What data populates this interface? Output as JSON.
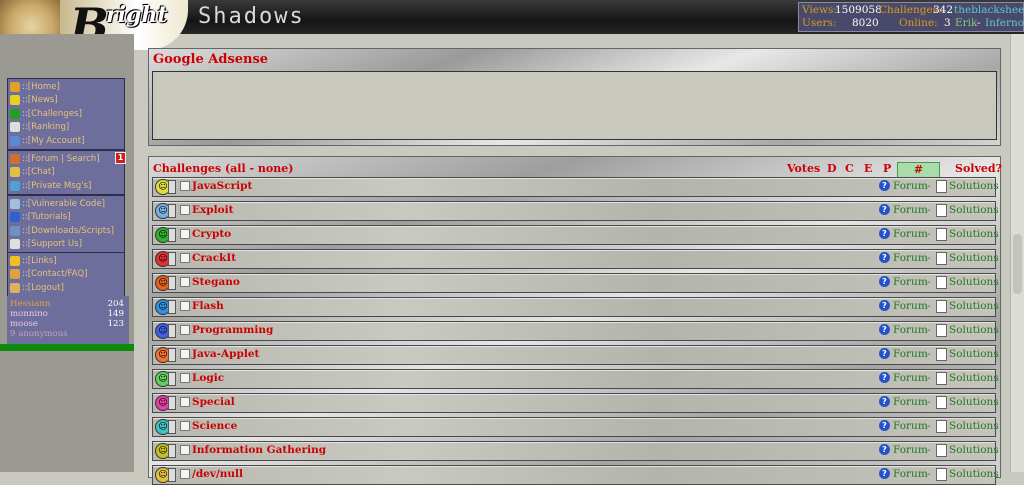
{
  "header": {
    "logo_b": "B",
    "logo_right": "right",
    "logo_shadows": "Shadows"
  },
  "stats": {
    "views_label": "Views:",
    "views": "1509058",
    "challenges_label": "Challenges:",
    "challenges": "342",
    "top_user": "theblacksheep",
    "users_label": "Users:",
    "users": "8020",
    "online_label": "Online:",
    "online": "3",
    "online_user1": "Erik",
    "online_sep": "-",
    "online_user2": "Inferno"
  },
  "menu_prefix": "::",
  "menu_groups": [
    [
      {
        "label": "[Home]",
        "icon": "home-icon",
        "color": "#e0a030"
      },
      {
        "label": "[News]",
        "icon": "warning-icon",
        "color": "#e8d020"
      },
      {
        "label": "[Challenges]",
        "icon": "play-icon",
        "color": "#20a020"
      },
      {
        "label": "[Ranking]",
        "icon": "ranking-icon",
        "color": "#dddddd"
      },
      {
        "label": "[My Account]",
        "icon": "account-icon",
        "color": "#5a8ad0"
      }
    ],
    [
      {
        "label": "[Forum | Search]",
        "icon": "forum-icon",
        "color": "#d07030"
      },
      {
        "label": "[Chat]",
        "icon": "chat-icon",
        "color": "#e0c040"
      },
      {
        "label": "[Private Msg's]",
        "icon": "message-icon",
        "color": "#50a0d0"
      }
    ],
    [
      {
        "label": "[Vulnerable Code]",
        "icon": "code-icon",
        "color": "#a0c0e0"
      },
      {
        "label": "[Tutorials]",
        "icon": "help-icon",
        "color": "#3060d0"
      },
      {
        "label": "[Downloads/Scripts]",
        "icon": "download-icon",
        "color": "#7090c0"
      },
      {
        "label": "[Support Us]",
        "icon": "support-icon",
        "color": "#e0e0e0"
      }
    ],
    [
      {
        "label": "[Links]",
        "icon": "star-icon",
        "color": "#f0c020"
      },
      {
        "label": "[Contact/FAQ]",
        "icon": "contact-icon",
        "color": "#e0a040"
      },
      {
        "label": "[Logout]",
        "icon": "logout-icon",
        "color": "#e0b060"
      }
    ]
  ],
  "notify_count": "1",
  "online_users": [
    {
      "name": "Hessiann",
      "count": "204",
      "color": "#e0a040"
    },
    {
      "name": "monnino",
      "count": "149",
      "color": "#e8c8e8"
    },
    {
      "name": "moose",
      "count": "123",
      "color": "#e8c8e8"
    }
  ],
  "anonymous": "9 anonymous",
  "adsense": {
    "title": "Google Adsense"
  },
  "challenges": {
    "title": "Challenges (all - none)",
    "votes": "Votes",
    "d": "D",
    "c": "C",
    "e": "E",
    "p": "P",
    "hash": "#",
    "solved": "Solved?",
    "forum_label": "Forum",
    "separator": "-",
    "solutions_label": "Solutions",
    "rows": [
      {
        "name": "JavaScript",
        "color": "#dede40",
        "icon": "javascript-face-icon"
      },
      {
        "name": "Exploit",
        "color": "#7ab0e0",
        "icon": "exploit-face-icon"
      },
      {
        "name": "Crypto",
        "color": "#30b030",
        "icon": "crypto-face-icon"
      },
      {
        "name": "CrackIt",
        "color": "#e03030",
        "icon": "crackit-face-icon"
      },
      {
        "name": "Stegano",
        "color": "#e06020",
        "icon": "stegano-face-icon"
      },
      {
        "name": "Flash",
        "color": "#3090e0",
        "icon": "flash-face-icon"
      },
      {
        "name": "Programming",
        "color": "#4060e0",
        "icon": "programming-face-icon"
      },
      {
        "name": "Java-Applet",
        "color": "#f07030",
        "icon": "java-applet-face-icon"
      },
      {
        "name": "Logic",
        "color": "#60d060",
        "icon": "logic-face-icon"
      },
      {
        "name": "Special",
        "color": "#e040a0",
        "icon": "special-face-icon"
      },
      {
        "name": "Science",
        "color": "#40c0c0",
        "icon": "science-face-icon"
      },
      {
        "name": "Information Gathering",
        "color": "#c0c020",
        "icon": "information-gathering-face-icon"
      },
      {
        "name": "/dev/null",
        "color": "#e0c040",
        "icon": "dev-null-face-icon"
      }
    ]
  }
}
